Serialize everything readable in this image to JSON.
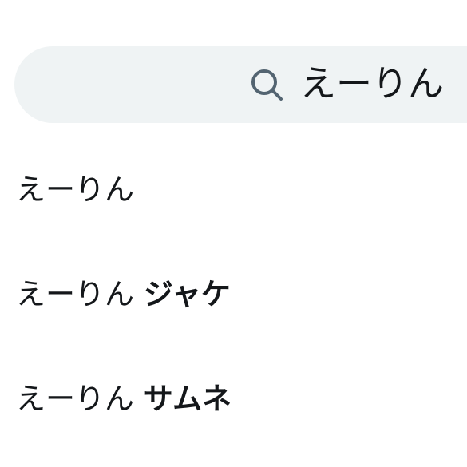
{
  "search": {
    "query": "えーりん",
    "icon": "search-icon"
  },
  "suggestions": [
    {
      "prefix": "えーりん",
      "completion": ""
    },
    {
      "prefix": "えーりん",
      "completion": "ジャケ"
    },
    {
      "prefix": "えーりん",
      "completion": "サムネ"
    }
  ],
  "colors": {
    "search_bg": "#eff3f4",
    "icon": "#536471",
    "text": "#14171a"
  }
}
